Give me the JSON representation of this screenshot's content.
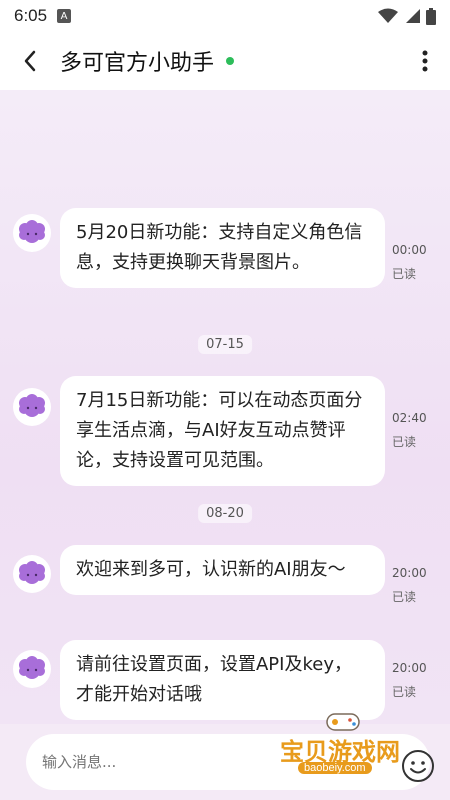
{
  "status_bar": {
    "time": "6:05",
    "a_badge": "A"
  },
  "header": {
    "title": "多可官方小助手",
    "online_color": "#2dbd5a"
  },
  "messages": [
    {
      "text": "5月20日新功能：支持自定义角色信息，支持更换聊天背景图片。",
      "time": "00:00",
      "read": "已读"
    },
    {
      "text": "7月15日新功能：可以在动态页面分享生活点滴，与AI好友互动点赞评论，支持设置可见范围。",
      "time": "02:40",
      "read": "已读"
    },
    {
      "text": "欢迎来到多可，认识新的AI朋友～",
      "time": "20:00",
      "read": "已读"
    },
    {
      "text": "请前往设置页面，设置API及key，才能开始对话哦",
      "time": "20:00",
      "read": "已读"
    }
  ],
  "dates": [
    "07-15",
    "08-20"
  ],
  "input": {
    "placeholder": "输入消息..."
  },
  "watermark": {
    "brand": "宝贝游戏网",
    "url": "baobeiy.com"
  },
  "colors": {
    "avatar": "#a86ed9",
    "accent_bg": "#f3e9f6"
  }
}
